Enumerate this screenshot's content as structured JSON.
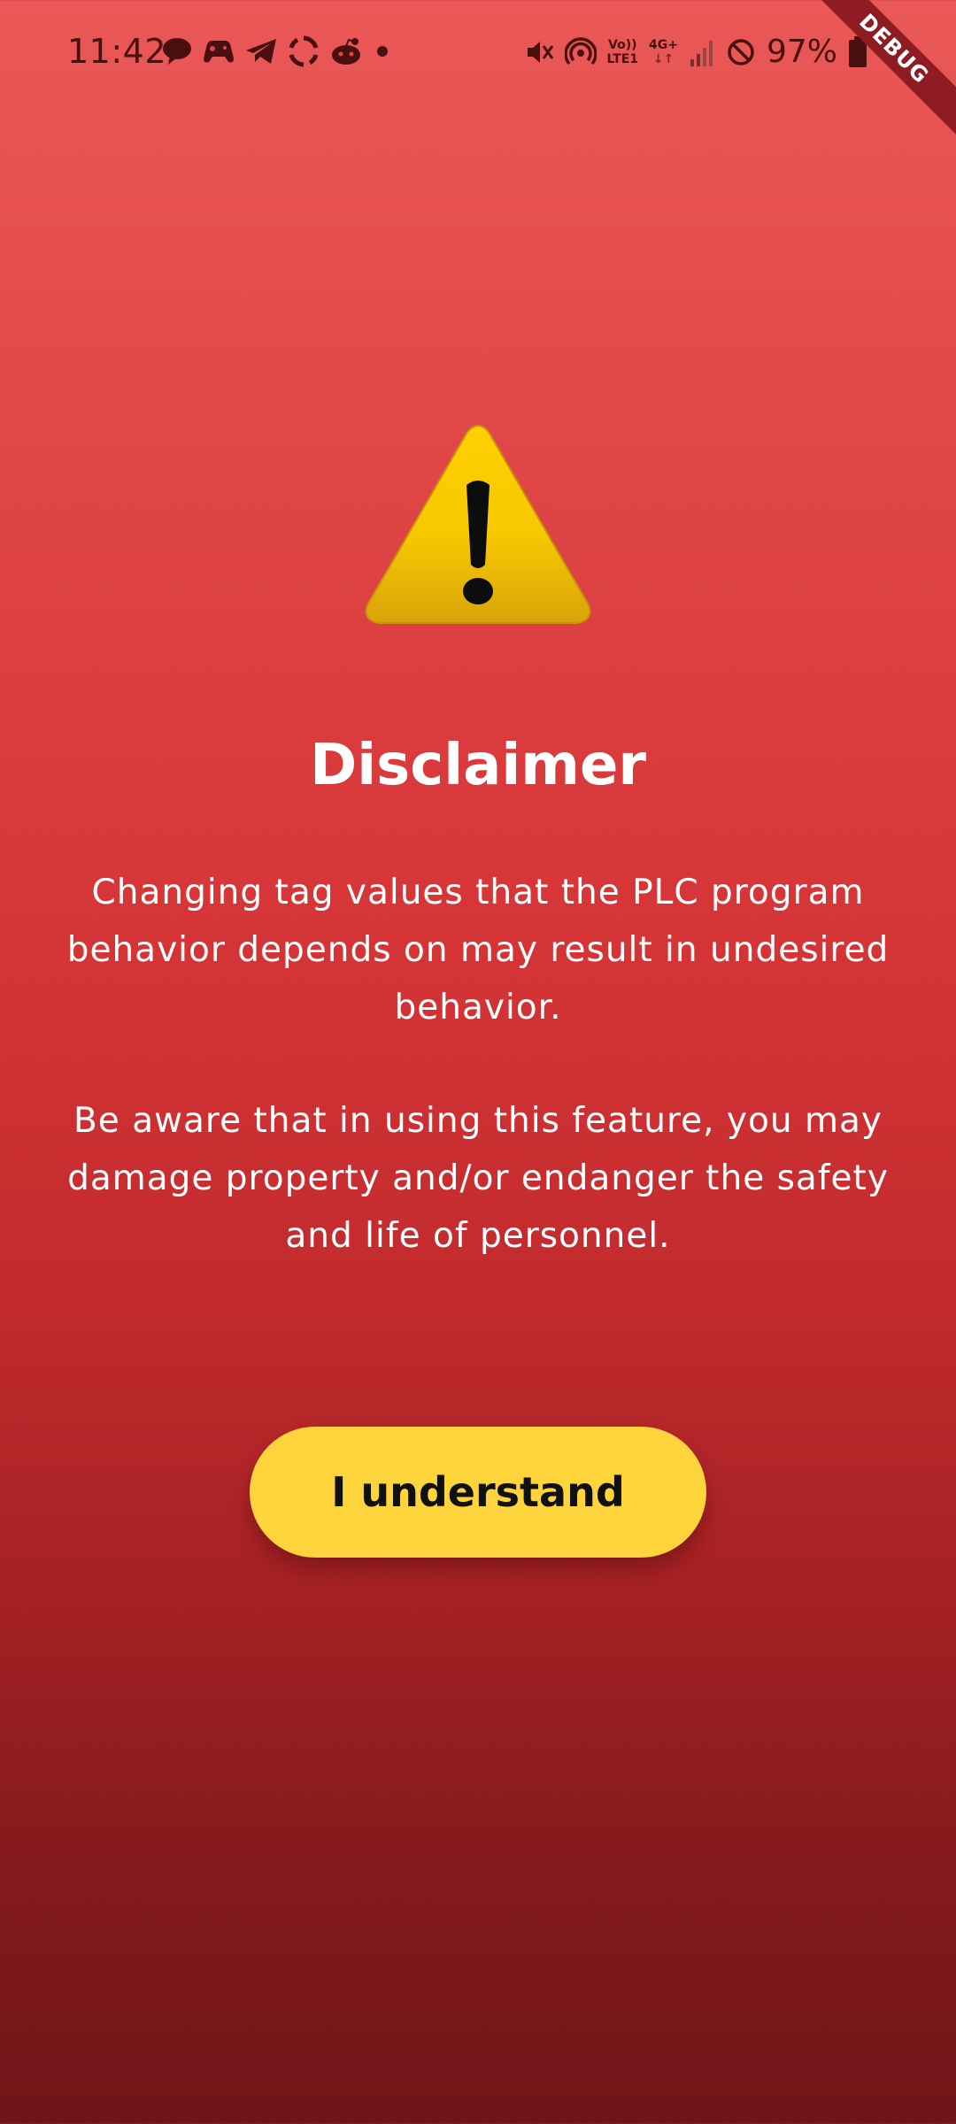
{
  "status_bar": {
    "time": "11:42",
    "battery_percent": "97%",
    "network_top": "Vo))",
    "network_bottom": "LTE1",
    "data_type": "4G+",
    "notification_icons": [
      "chat-bubble-icon",
      "game-controller-icon",
      "telegram-icon",
      "sync-icon",
      "reddit-icon",
      "dot-icon"
    ],
    "system_icons": [
      "mute-icon",
      "hotspot-icon",
      "volte-icon",
      "data-arrows-icon",
      "signal-icon",
      "do-not-disturb-icon",
      "battery-icon"
    ]
  },
  "debug_banner": {
    "label": "DEBUG"
  },
  "disclaimer": {
    "icon": "warning-triangle-icon",
    "title": "Disclaimer",
    "paragraph_1": "Changing tag values that the PLC program behavior depends on may result in undesired behavior.",
    "paragraph_2": "Be aware that in using this feature, you may damage property and/or endanger the safety and life of personnel.",
    "button_label": "I understand"
  },
  "colors": {
    "background_top": "#ea5858",
    "background_bottom": "#6f1518",
    "button": "#fdd43b",
    "warning_yellow": "#f7c800"
  }
}
